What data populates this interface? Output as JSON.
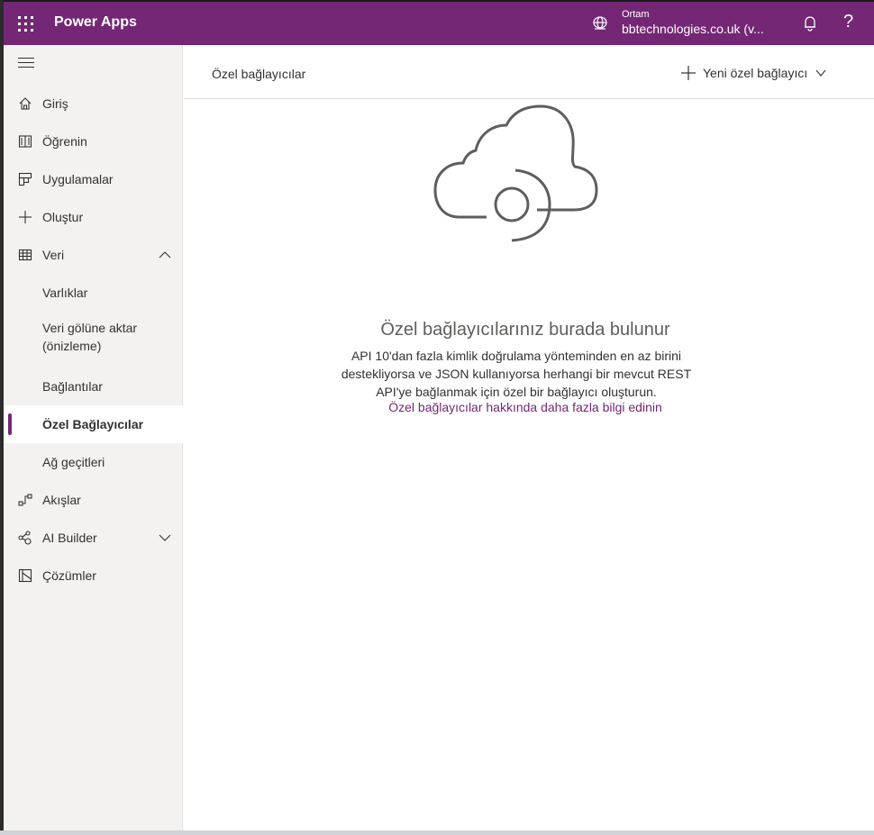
{
  "topbar": {
    "app_title": "Power Apps",
    "env_label": "Ortam",
    "env_name": "bbtechnologies.co.uk (v...",
    "help_glyph": "?",
    "icons": [
      "waffle-icon",
      "globe-icon",
      "bell-icon",
      "help-icon"
    ],
    "brand_color": "#742774"
  },
  "sidebar": {
    "items": [
      {
        "label": "Giriş",
        "icon": "home-icon"
      },
      {
        "label": "Öğrenin",
        "icon": "book-icon"
      },
      {
        "label": "Uygulamalar",
        "icon": "apps-icon"
      },
      {
        "label": "Oluştur",
        "icon": "plus-icon"
      },
      {
        "label": "Veri",
        "icon": "table-icon",
        "expanded": true
      },
      {
        "label": "Varlıklar"
      },
      {
        "label": "Veri gölüne aktar (önizleme)"
      },
      {
        "label": "Bağlantılar"
      },
      {
        "label": "Özel Bağlayıcılar",
        "active": true
      },
      {
        "label": "Ağ geçitleri"
      },
      {
        "label": "Akışlar",
        "icon": "flow-icon"
      },
      {
        "label": "AI Builder",
        "icon": "ai-builder-icon",
        "expanded": false
      },
      {
        "label": "Çözümler",
        "icon": "solutions-icon"
      }
    ]
  },
  "main": {
    "title": "Özel bağlayıcılar",
    "new_button_label": "Yeni özel bağlayıcı",
    "empty_state": {
      "title": "Özel bağlayıcılarınız burada bulunur",
      "description": "API 10'dan fazla kimlik doğrulama yönteminden en az birini destekliyorsa ve JSON kullanıyorsa herhangi bir mevcut REST API'ye bağlanmak için özel bir bağlayıcı oluşturun.",
      "link": "Özel bağlayıcılar hakkında daha fazla bilgi edinin",
      "illustration": "cloud-connector-icon"
    }
  }
}
